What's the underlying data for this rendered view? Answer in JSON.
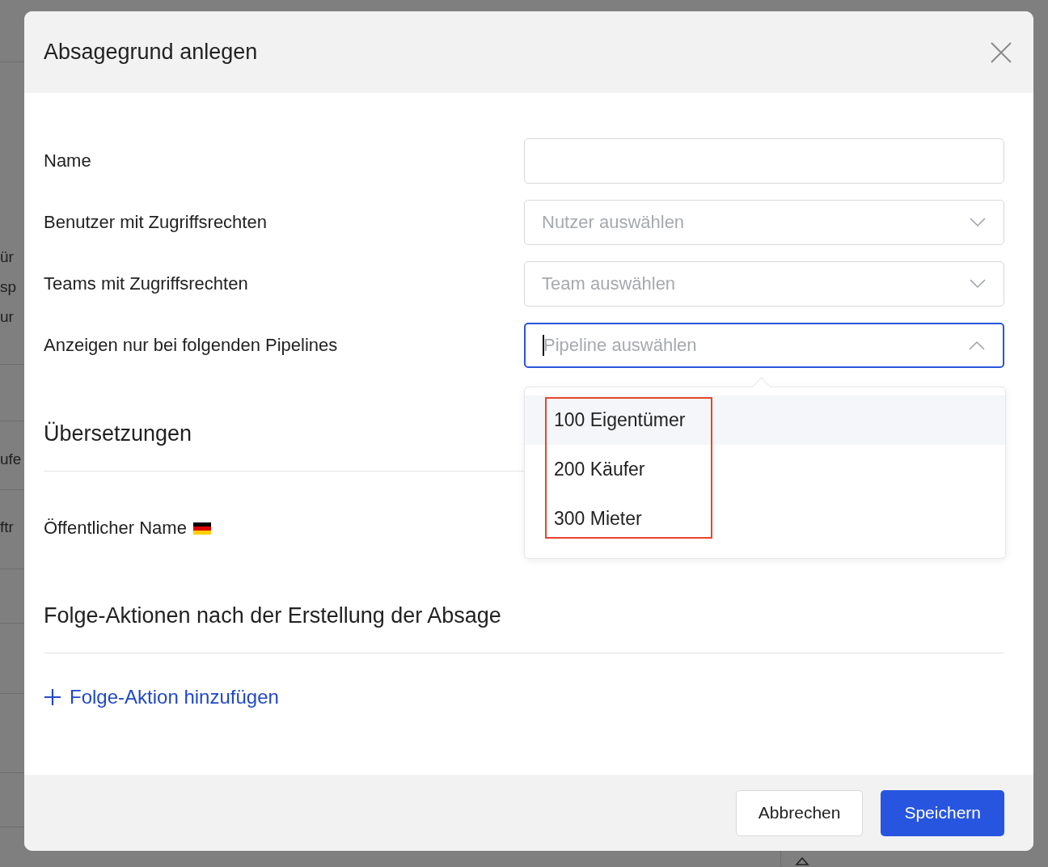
{
  "background": {
    "fragments": [
      "ür",
      "sp",
      "ur",
      "ufe",
      "ftr"
    ]
  },
  "dialog": {
    "title": "Absagegrund anlegen",
    "fields": [
      {
        "label": "Name",
        "kind": "text"
      },
      {
        "label": "Benutzer mit Zugriffsrechten",
        "kind": "select",
        "placeholder": "Nutzer auswählen",
        "focused": false,
        "expanded": false
      },
      {
        "label": "Teams mit Zugriffsrechten",
        "kind": "select",
        "placeholder": "Team auswählen",
        "focused": false,
        "expanded": false
      },
      {
        "label": "Anzeigen nur bei folgenden Pipelines",
        "kind": "select",
        "placeholder": "Pipeline auswählen",
        "focused": true,
        "expanded": true,
        "annotation_box": true,
        "options": [
          {
            "label": "100 Eigentümer",
            "highlighted": true
          },
          {
            "label": "200 Käufer",
            "highlighted": false
          },
          {
            "label": "300 Mieter",
            "highlighted": false
          }
        ]
      }
    ],
    "translations": {
      "heading": "Übersetzungen",
      "fields": [
        {
          "label": "Öffentlicher Name"
        }
      ]
    },
    "follow_up": {
      "heading": "Folge-Aktionen nach der Erstellung der Absage",
      "add_link": "Folge-Aktion hinzufügen"
    },
    "buttons": [
      {
        "label": "Abbrechen",
        "kind": "secondary"
      },
      {
        "label": "Speichern",
        "kind": "primary"
      }
    ]
  }
}
